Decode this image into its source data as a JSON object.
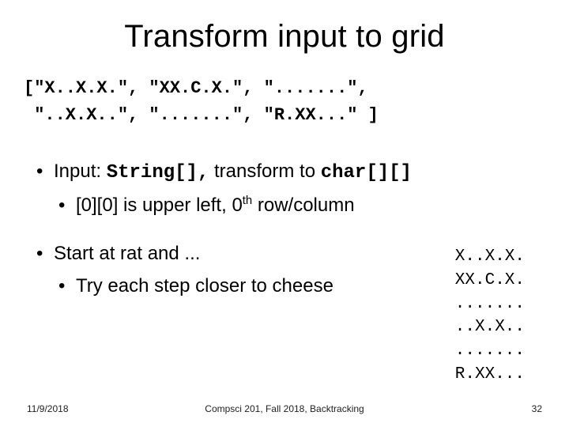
{
  "title": "Transform input to grid",
  "code": {
    "line1": "[\"X..X.X.\", \"XX.C.X.\", \".......\",",
    "line2": " \"..X.X..\", \".......\", \"R.XX...\" ]"
  },
  "bullets": {
    "input_prefix": "Input: ",
    "input_code1": "String[],",
    "input_mid": "  transform to ",
    "input_code2": "char[][]",
    "index_a": "[0][0] is upper left, 0",
    "index_sup": "th",
    "index_b": " row/column",
    "start": "Start at rat and ...",
    "try": "Try each step closer to cheese"
  },
  "grid": {
    "r0": "X..X.X.",
    "r1": "XX.C.X.",
    "r2": ".......",
    "r3": "..X.X..",
    "r4": ".......",
    "r5": "R.XX..."
  },
  "footer": {
    "date": "11/9/2018",
    "mid": "Compsci 201, Fall 2018,  Backtracking",
    "page": "32"
  }
}
